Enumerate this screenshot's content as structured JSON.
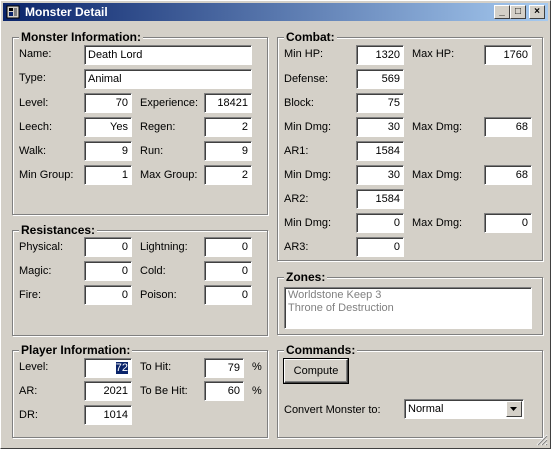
{
  "window": {
    "title": "Monster Detail",
    "min": "_",
    "max": "□",
    "close": "×"
  },
  "monster": {
    "legend": "Monster Information:",
    "name_label": "Name:",
    "name": "Death Lord",
    "type_label": "Type:",
    "type": "Animal",
    "level_label": "Level:",
    "level": "70",
    "exp_label": "Experience:",
    "exp": "18421",
    "leech_label": "Leech:",
    "leech": "Yes",
    "regen_label": "Regen:",
    "regen": "2",
    "walk_label": "Walk:",
    "walk": "9",
    "run_label": "Run:",
    "run": "9",
    "mingroup_label": "Min Group:",
    "mingroup": "1",
    "maxgroup_label": "Max Group:",
    "maxgroup": "2"
  },
  "resist": {
    "legend": "Resistances:",
    "physical_label": "Physical:",
    "physical": "0",
    "lightning_label": "Lightning:",
    "lightning": "0",
    "magic_label": "Magic:",
    "magic": "0",
    "cold_label": "Cold:",
    "cold": "0",
    "fire_label": "Fire:",
    "fire": "0",
    "poison_label": "Poison:",
    "poison": "0"
  },
  "player": {
    "legend": "Player Information:",
    "level_label": "Level:",
    "level": "72",
    "tohit_label": "To Hit:",
    "tohit": "79",
    "tohit_unit": "%",
    "ar_label": "AR:",
    "ar": "2021",
    "tobehit_label": "To Be Hit:",
    "tobehit": "60",
    "tobehit_unit": "%",
    "dr_label": "DR:",
    "dr": "1014"
  },
  "combat": {
    "legend": "Combat:",
    "minhp_label": "Min HP:",
    "minhp": "1320",
    "maxhp_label": "Max HP:",
    "maxhp": "1760",
    "defense_label": "Defense:",
    "defense": "569",
    "block_label": "Block:",
    "block": "75",
    "mindmg1_label": "Min Dmg:",
    "mindmg1": "30",
    "maxdmg1_label": "Max Dmg:",
    "maxdmg1": "68",
    "ar1_label": "AR1:",
    "ar1": "1584",
    "mindmg2_label": "Min Dmg:",
    "mindmg2": "30",
    "maxdmg2_label": "Max Dmg:",
    "maxdmg2": "68",
    "ar2_label": "AR2:",
    "ar2": "1584",
    "mindmg3_label": "Min Dmg:",
    "mindmg3": "0",
    "maxdmg3_label": "Max Dmg:",
    "maxdmg3": "0",
    "ar3_label": "AR3:",
    "ar3": "0"
  },
  "zones": {
    "legend": "Zones:",
    "items": [
      "Worldstone Keep 3",
      "Throne of Destruction"
    ]
  },
  "commands": {
    "legend": "Commands:",
    "compute_label": "Compute",
    "convert_label": "Convert Monster to:",
    "convert_value": "Normal"
  },
  "icons": {
    "app": "app-icon",
    "dropdown": "dropdown-arrow-icon",
    "grip": "resize-grip-icon"
  },
  "colors": {
    "titlebar_start": "#0a246a",
    "titlebar_end": "#a6caf0",
    "face": "#d4d0c8"
  }
}
